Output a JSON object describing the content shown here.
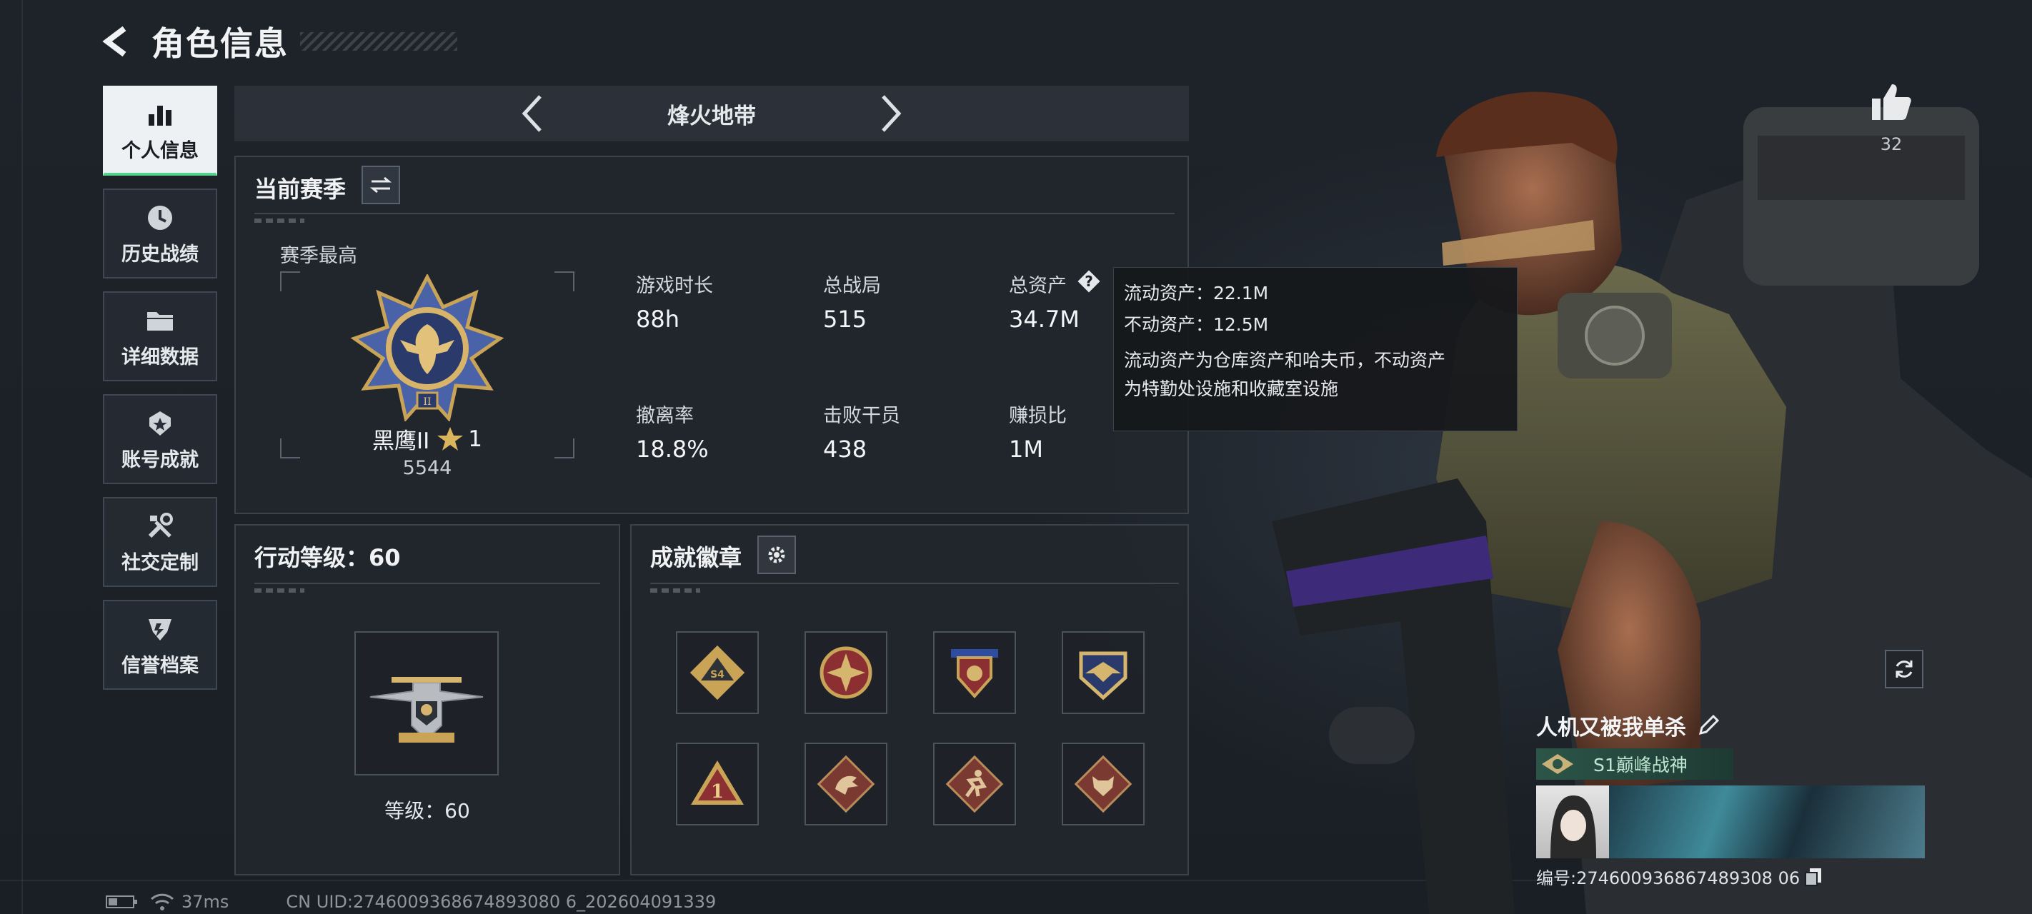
{
  "header": {
    "title": "角色信息"
  },
  "sidebar": {
    "items": [
      {
        "label": "个人信息",
        "icon": "bar-chart-icon",
        "active": true
      },
      {
        "label": "历史战绩",
        "icon": "clock-icon",
        "active": false
      },
      {
        "label": "详细数据",
        "icon": "folder-icon",
        "active": false
      },
      {
        "label": "账号成就",
        "icon": "achievement-icon",
        "active": false
      },
      {
        "label": "社交定制",
        "icon": "tools-icon",
        "active": false
      },
      {
        "label": "信誉档案",
        "icon": "reputation-icon",
        "active": false
      }
    ]
  },
  "mode": {
    "name": "烽火地带"
  },
  "season": {
    "title": "当前赛季",
    "best_label": "赛季最高",
    "rank_name": "黑鹰II",
    "rank_stars": "1",
    "rank_score": "5544",
    "stats": [
      {
        "label": "游戏时长",
        "value": "88h"
      },
      {
        "label": "总战局",
        "value": "515"
      },
      {
        "label": "总资产",
        "value": "34.7M"
      },
      {
        "label": "撤离率",
        "value": "18.8%"
      },
      {
        "label": "击败干员",
        "value": "438"
      },
      {
        "label": "赚损比",
        "value": "1M"
      }
    ]
  },
  "tooltip": {
    "liquid": "流动资产：22.1M",
    "fixed": "不动资产：12.5M",
    "desc_line1": "流动资产为仓库资产和哈夫币，不动资产",
    "desc_line2": "为特勤处设施和收藏室设施"
  },
  "action_level": {
    "title": "行动等级：60",
    "level_text": "等级：60"
  },
  "achievements": {
    "title": "成就徽章",
    "badges": [
      "s4-badge",
      "compass-badge",
      "shield-star-badge",
      "eagle-badge",
      "number-one-badge",
      "dragon-badge",
      "runner-badge",
      "wolf-badge"
    ]
  },
  "player": {
    "like_count": "32",
    "name": "人机又被我单杀",
    "title": "S1巅峰战神",
    "id_text": "编号:274600936867489308 06"
  },
  "status": {
    "ping": "37ms",
    "uid": "CN UID:2746009368674893080 6_202604091339"
  },
  "colors": {
    "accent": "#52d38c",
    "gold": "#c9a356",
    "panel": "#22272e"
  }
}
